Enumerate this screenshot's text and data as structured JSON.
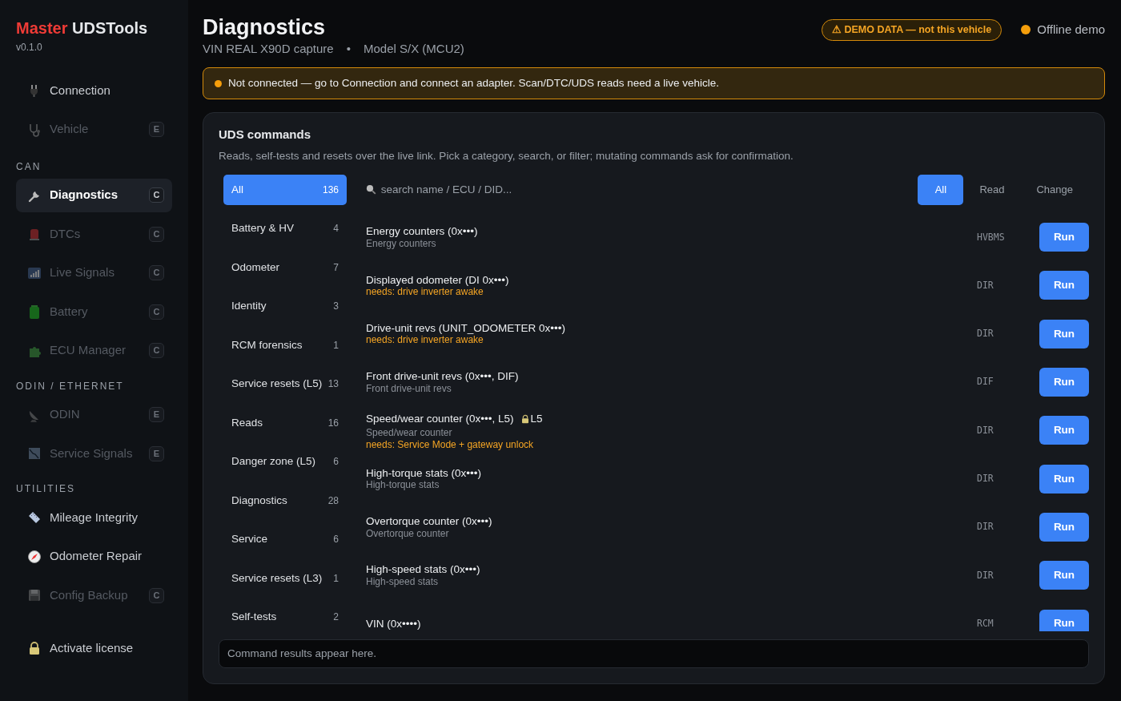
{
  "app": {
    "brand_accent": "Master",
    "brand_rest": "UDSTools",
    "version": "v0.1.0"
  },
  "sidebar": {
    "sections": [
      {
        "items": [
          {
            "label": "Connection",
            "disabled": false,
            "selected": false
          },
          {
            "label": "Vehicle",
            "badge": "E",
            "disabled": true,
            "selected": false
          }
        ]
      },
      {
        "heading": "CAN",
        "items": [
          {
            "label": "Diagnostics",
            "badge": "C",
            "disabled": false,
            "selected": true
          },
          {
            "label": "DTCs",
            "badge": "C",
            "disabled": true,
            "selected": false
          },
          {
            "label": "Live Signals",
            "badge": "C",
            "disabled": true,
            "selected": false
          },
          {
            "label": "Battery",
            "badge": "C",
            "disabled": true,
            "selected": false
          },
          {
            "label": "ECU Manager",
            "badge": "C",
            "disabled": true,
            "selected": false
          }
        ]
      },
      {
        "heading": "ODIN / ETHERNET",
        "items": [
          {
            "label": "ODIN",
            "badge": "E",
            "disabled": true,
            "selected": false
          },
          {
            "label": "Service Signals",
            "badge": "E",
            "disabled": true,
            "selected": false
          }
        ]
      },
      {
        "heading": "UTILITIES",
        "items": [
          {
            "label": "Mileage Integrity",
            "disabled": false,
            "selected": false
          },
          {
            "label": "Odometer Repair",
            "disabled": false,
            "selected": false
          },
          {
            "label": "Config Backup",
            "badge": "C",
            "disabled": true,
            "selected": false
          }
        ]
      }
    ],
    "license": {
      "label": "Activate license"
    }
  },
  "header": {
    "title": "Diagnostics",
    "subtitle_parts": [
      "VIN REAL X90D capture",
      "•",
      "Model S/X (MCU2)"
    ],
    "demo_badge": "⚠ DEMO DATA — not this vehicle",
    "status": {
      "label": "Offline demo",
      "color": "#f59e0b"
    }
  },
  "alert": {
    "text": "Not connected — go to Connection and connect an adapter. Scan/DTC/UDS reads need a live vehicle.",
    "color": "#f59e0b"
  },
  "panel": {
    "title": "UDS commands",
    "description": "Reads, self-tests and resets over the live link. Pick a category, search, or filter; mutating commands ask for confirmation.",
    "categories": [
      {
        "label": "All",
        "count": "136",
        "selected": true
      },
      {
        "label": "Battery & HV",
        "count": "4",
        "selected": false
      },
      {
        "label": "Odometer",
        "count": "7",
        "selected": false
      },
      {
        "label": "Identity",
        "count": "3",
        "selected": false
      },
      {
        "label": "RCM forensics",
        "count": "1",
        "selected": false
      },
      {
        "label": "Service resets (L5)",
        "count": "13",
        "selected": false
      },
      {
        "label": "Reads",
        "count": "16",
        "selected": false
      },
      {
        "label": "Danger zone (L5)",
        "count": "6",
        "selected": false
      },
      {
        "label": "Diagnostics",
        "count": "28",
        "selected": false
      },
      {
        "label": "Service",
        "count": "6",
        "selected": false
      },
      {
        "label": "Service resets (L3)",
        "count": "1",
        "selected": false
      },
      {
        "label": "Self-tests",
        "count": "2",
        "selected": false
      }
    ],
    "search": {
      "placeholder": "search name / ECU / DID..."
    },
    "filters": [
      {
        "label": "All",
        "selected": true
      },
      {
        "label": "Read",
        "selected": false
      },
      {
        "label": "Change",
        "selected": false
      }
    ],
    "commands": [
      {
        "name": "Energy counters (0x•••)",
        "description": "Energy counters",
        "ecu": "HVBMS",
        "button": "Run"
      },
      {
        "name": "Displayed odometer (DI 0x•••)",
        "needs": "needs: drive inverter awake",
        "ecu": "DIR",
        "button": "Run"
      },
      {
        "name": "Drive-unit revs (UNIT_ODOMETER 0x•••)",
        "needs": "needs: drive inverter awake",
        "ecu": "DIR",
        "button": "Run"
      },
      {
        "name": "Front drive-unit revs (0x•••, DIF)",
        "description": "Front drive-unit revs",
        "ecu": "DIF",
        "button": "Run"
      },
      {
        "name": "Speed/wear counter (0x•••, L5)",
        "lock": "L5",
        "description": "Speed/wear counter",
        "needs": "needs: Service Mode + gateway unlock",
        "ecu": "DIR",
        "button": "Run"
      },
      {
        "name": "High-torque stats (0x•••)",
        "description": "High-torque stats",
        "ecu": "DIR",
        "button": "Run"
      },
      {
        "name": "Overtorque counter (0x•••)",
        "description": "Overtorque counter",
        "ecu": "DIR",
        "button": "Run"
      },
      {
        "name": "High-speed stats (0x•••)",
        "description": "High-speed stats",
        "ecu": "DIR",
        "button": "Run"
      },
      {
        "name": "VIN (0x••••)",
        "ecu": "RCM",
        "button": "Run"
      }
    ],
    "results": {
      "placeholder": "Command results appear here."
    }
  }
}
